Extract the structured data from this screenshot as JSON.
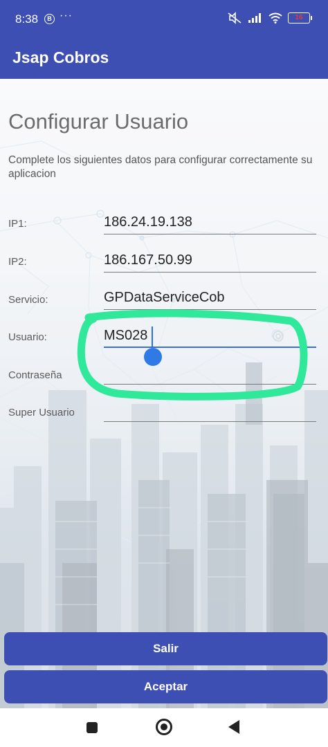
{
  "status_bar": {
    "time": "8:38",
    "badge_letter": "B",
    "more": "···",
    "battery": "16",
    "icons": [
      "mute-icon",
      "signal-icon",
      "wifi-icon",
      "battery-icon"
    ]
  },
  "app_bar": {
    "title": "Jsap Cobros"
  },
  "form": {
    "title": "Configurar Usuario",
    "subtitle": "Complete los siguientes datos para configurar correctamente su aplicacion",
    "fields": [
      {
        "label": "IP1:",
        "value": "186.24.19.138"
      },
      {
        "label": "IP2:",
        "value": "186.167.50.99"
      },
      {
        "label": "Servicio:",
        "value": "GPDataServiceCob"
      },
      {
        "label": "Usuario:",
        "value": "MS028"
      },
      {
        "label": "Contraseña",
        "value": ""
      },
      {
        "label": "Super Usuario",
        "value": ""
      }
    ]
  },
  "buttons": {
    "salir": "Salir",
    "aceptar": "Aceptar"
  },
  "nav_bar": {
    "icons": [
      "recents-icon",
      "home-icon",
      "back-icon"
    ]
  },
  "colors": {
    "primary": "#3d4fb3",
    "highlight": "#2fe89a",
    "cursor": "#2f7ae6"
  }
}
